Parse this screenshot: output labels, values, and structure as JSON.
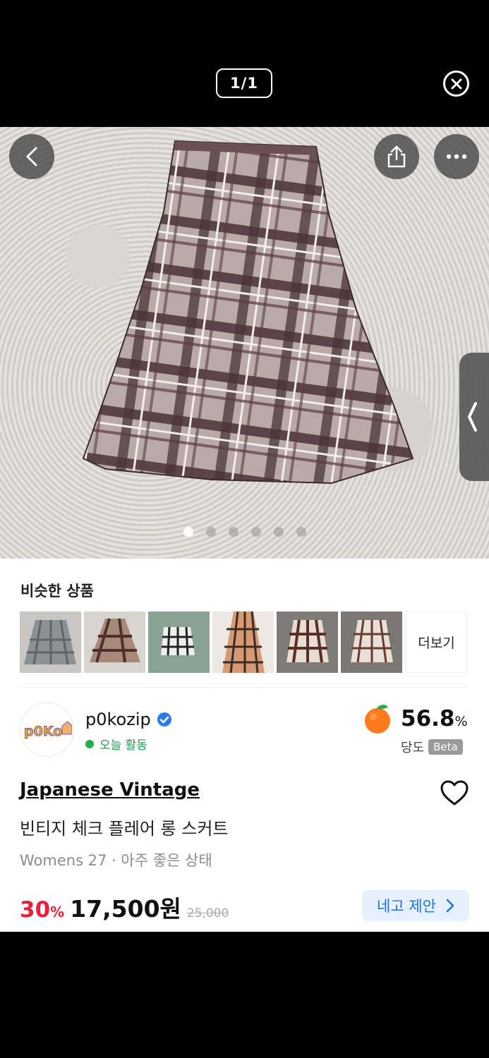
{
  "viewer": {
    "counter": "1/1"
  },
  "gallery": {
    "image_count": 6,
    "active_index": 0
  },
  "similar": {
    "title": "비슷한 상품",
    "more_label": "더보기",
    "thumb_count": 6
  },
  "seller": {
    "avatar_text": "p0Ko",
    "name": "p0kozip",
    "status": "오늘 활동",
    "score_value": "56.8",
    "score_unit": "%",
    "score_label": "당도",
    "beta_label": "Beta"
  },
  "product": {
    "brand": "Japanese Vintage",
    "title": "빈티지 체크 플레어 롱 스커트",
    "meta": "Womens 27 · 아주 좋은 상태",
    "discount_value": "30",
    "discount_unit": "%",
    "price": "17,500원",
    "original_price": "25,000",
    "offer_label": "네고 제안"
  },
  "colors": {
    "accent_blue": "#1c73e8",
    "discount_red": "#e3233b",
    "active_green": "#22b04a"
  }
}
